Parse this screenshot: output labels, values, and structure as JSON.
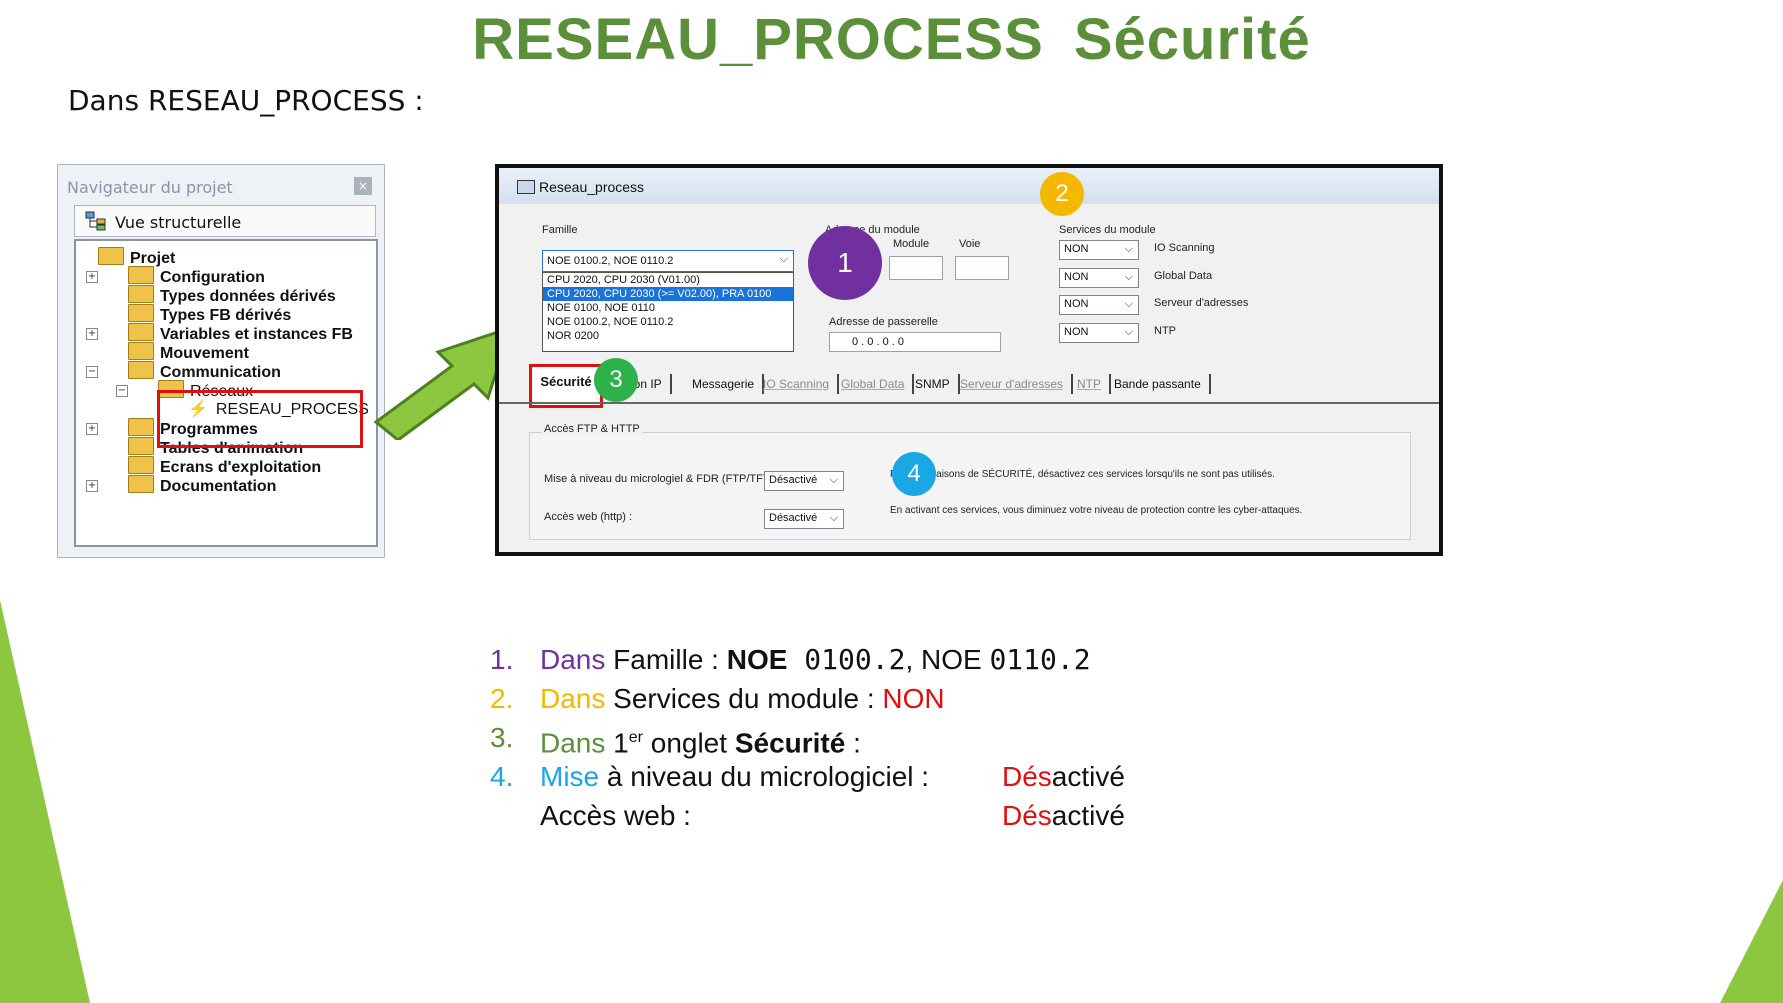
{
  "slide": {
    "title_part1": "RESEAU_PROCESS",
    "title_part2": "Sécurité",
    "subtitle": "Dans RESEAU_PROCESS :"
  },
  "navigator": {
    "title": "Navigateur du projet",
    "close_glyph": "×",
    "view_label": "Vue structurelle",
    "tree": [
      {
        "label": "Projet"
      },
      {
        "label": "Configuration"
      },
      {
        "label": "Types données dérivés"
      },
      {
        "label": "Types FB dérivés"
      },
      {
        "label": "Variables et instances FB"
      },
      {
        "label": "Mouvement"
      },
      {
        "label": "Communication"
      },
      {
        "label": "Réseaux"
      },
      {
        "label": "RESEAU_PROCESS"
      },
      {
        "label": "Programmes"
      },
      {
        "label": "Tables d'animation"
      },
      {
        "label": "Ecrans d'exploitation"
      },
      {
        "label": "Documentation"
      }
    ],
    "expand_glyph": "+",
    "collapse_glyph": "−"
  },
  "dialog": {
    "title": "Reseau_process",
    "famille_label": "Famille",
    "famille_value": "NOE 0100.2, NOE 0110.2",
    "famille_options": [
      "CPU 2020, CPU 2030 (V01.00)",
      "CPU 2020, CPU 2030 (>= V02.00), PRA 0100",
      "NOE 0100, NOE 0110",
      "NOE 0100.2, NOE 0110.2",
      "NOR 0200"
    ],
    "adresse_module_label": "Adresse du module",
    "module_label": "Module",
    "voie_label": "Voie",
    "passerelle_label": "Adresse de passerelle",
    "passerelle_value": "0   .   0   .   0   .   0",
    "services_label": "Services du module",
    "services": [
      {
        "value": "NON",
        "label": "IO Scanning"
      },
      {
        "value": "NON",
        "label": "Global Data"
      },
      {
        "value": "NON",
        "label": "Serveur d'adresses"
      },
      {
        "value": "NON",
        "label": "NTP"
      }
    ],
    "tabs": {
      "securite": "Sécurité",
      "config_ip": "ration IP",
      "messagerie": "Messagerie",
      "io_scanning": "IO Scanning",
      "global_data": "Global Data",
      "snmp": "SNMP",
      "serveur": "Serveur d'adresses",
      "ntp": "NTP",
      "bande": "Bande passante"
    },
    "group_label": "Accès FTP & HTTP",
    "ftp_label": "Mise à niveau du micrologiel & FDR (FTP/TFTP):",
    "ftp_value": "Désactivé",
    "web_label": "Accès web (http) :",
    "web_value": "Désactivé",
    "note1": "Pour des raisons de SÉCURITÉ, désactivez ces services lorsqu'ils ne sont pas utilisés.",
    "note2": "En activant ces services, vous diminuez votre niveau de protection contre les cyber-attaques.",
    "chevron_glyph": "⌵"
  },
  "badges": [
    {
      "text": "1",
      "color": "#7030a0"
    },
    {
      "text": "2",
      "color": "#f5b800"
    },
    {
      "text": "3",
      "color": "#2eb14a"
    },
    {
      "text": "4",
      "color": "#1aa7e6"
    }
  ],
  "steps": [
    {
      "num": "1.",
      "lead": "Dans",
      "rest": " Famille : ",
      "bold": "NOE",
      "mono": " 0100.2",
      "tail": ", NOE ",
      "mono2": "0110.2",
      "color": "#7030a0"
    },
    {
      "num": "2.",
      "lead": "Dans",
      "rest": " Services du module : ",
      "red": "NON",
      "color": "#f5b800"
    },
    {
      "num": "3.",
      "lead": "Dans",
      "rest": " 1",
      "sup": "er",
      "rest2": " onglet ",
      "bold": "Sécurité",
      "tail": " :",
      "color": "#5b8f3a"
    },
    {
      "num": "4.",
      "lead": "Mise",
      "rest": " à niveau du micrologiciel :",
      "val_red": "Dés",
      "val_rest": "activé",
      "color": "#1aa7e6"
    },
    {
      "num": "",
      "lead": "",
      "rest": "Accès web :",
      "val_red": "Dés",
      "val_rest": "activé",
      "color": "#111111"
    }
  ],
  "colors": {
    "title_green": "#5b8f3a",
    "accent_green": "#8dc63f",
    "highlight_red": "#e01010"
  }
}
